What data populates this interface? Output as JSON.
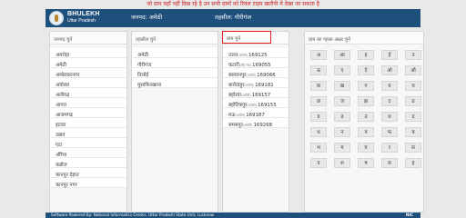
{
  "notice": "जो ग्राम यहाँ नहीं दिख रहे है उन सभी ग्रामों को रियल टाइम खतौनी में देखा जा सकता है",
  "header": {
    "brand_line1": "BHULEKH",
    "brand_line2": "Uttar Pradesh",
    "district_label": "जनपद: अमेठी",
    "tehsil_label": "तहसील: गौरीगंज"
  },
  "panels": {
    "districts": {
      "title": "जनपद चुनें",
      "items": [
        "अमरोहा",
        "अमेठी",
        "अम्बेडकरनगर",
        "अयोध्या",
        "अलीगढ़",
        "आगरा",
        "आजमगढ़",
        "इटावा",
        "उन्नाव",
        "एटा",
        "औरैया",
        "कन्नौज",
        "कानपुर देहात",
        "कानपुर नगर"
      ]
    },
    "tehsils": {
      "title": "तहसील चुनें",
      "items": [
        "अमेठी",
        "गौरीगंज",
        "तिलोई",
        "मुसाफिरखाना"
      ]
    },
    "villages": {
      "title": "ग्राम चुनें",
      "items": [
        {
          "name": "उत्तरा",
          "sub": "(अमेठी)",
          "code": "169125"
        },
        {
          "name": "कटारी",
          "sub": "(तहिं रोड)",
          "code": "169055"
        },
        {
          "name": "बसावनपुर",
          "sub": "(अमेठी)",
          "code": "169066"
        },
        {
          "name": "बारोदाहुर",
          "sub": "(अमेठी)",
          "code": "169181"
        },
        {
          "name": "बहोरवा",
          "sub": "(अमेठी)",
          "code": "169157"
        },
        {
          "name": "बहोरिकपुर",
          "sub": "(अमेठी)",
          "code": "169155"
        },
        {
          "name": "मऊ",
          "sub": "(अमेठी)",
          "code": "169187"
        },
        {
          "name": "समसपुर",
          "sub": "(अमेठी)",
          "code": "169268"
        }
      ]
    },
    "letters": {
      "title": "ग्राम का पहला अक्षर चुनें",
      "items": [
        "अ",
        "आ",
        "इ",
        "ई",
        "उ",
        "ऊ",
        "ए",
        "ऐ",
        "ओ",
        "औ",
        "क",
        "ख",
        "ग",
        "घ",
        "च",
        "छ",
        "ज",
        "झ",
        "ट",
        "ठ",
        "ड",
        "ढ",
        "त",
        "थ",
        "द",
        "ध",
        "न",
        "प",
        "फ",
        "ब",
        "भ",
        "म",
        "य",
        "र",
        "ल",
        "व",
        "श",
        "ष",
        "स",
        "ह"
      ]
    }
  },
  "footer": {
    "text": "Software Powered By: National Informatics Center, Uttar Pradesh State Unit, Lucknow",
    "nic_label": "NIC"
  }
}
